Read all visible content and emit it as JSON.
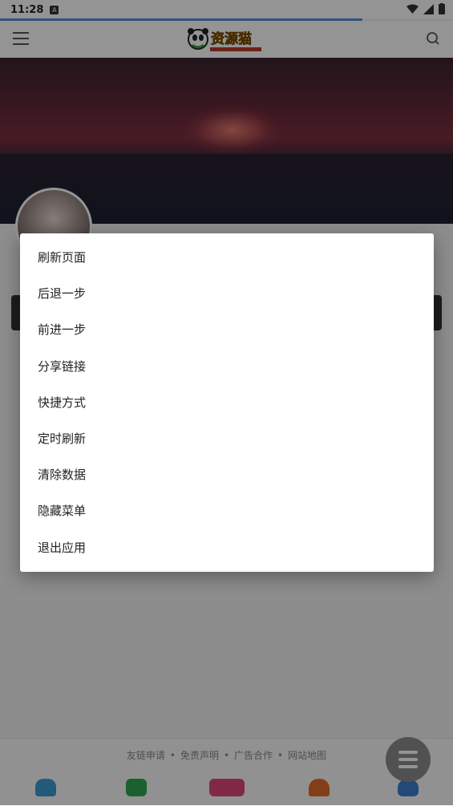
{
  "status_bar": {
    "time": "11:28",
    "notification_icon": "a-icon"
  },
  "app_bar": {
    "menu_icon": "hamburger-icon",
    "logo_text": "资源猫",
    "search_icon": "search-icon"
  },
  "footer": {
    "links": [
      "友链申请",
      "免责声明",
      "广告合作",
      "网站地图"
    ],
    "separator": "•"
  },
  "popup_menu": {
    "items": [
      "刷新页面",
      "后退一步",
      "前进一步",
      "分享链接",
      "快捷方式",
      "定时刷新",
      "清除数据",
      "隐藏菜单",
      "退出应用"
    ]
  },
  "colors": {
    "progress": "#5b8fd6",
    "scrim": "rgba(0,0,0,0.42)",
    "tab_home": "#3d9bd0",
    "tab_wallet": "#2fa84f",
    "tab_add": "#e0457b",
    "tab_bell": "#e26b2a",
    "tab_user": "#3d7fd0"
  }
}
